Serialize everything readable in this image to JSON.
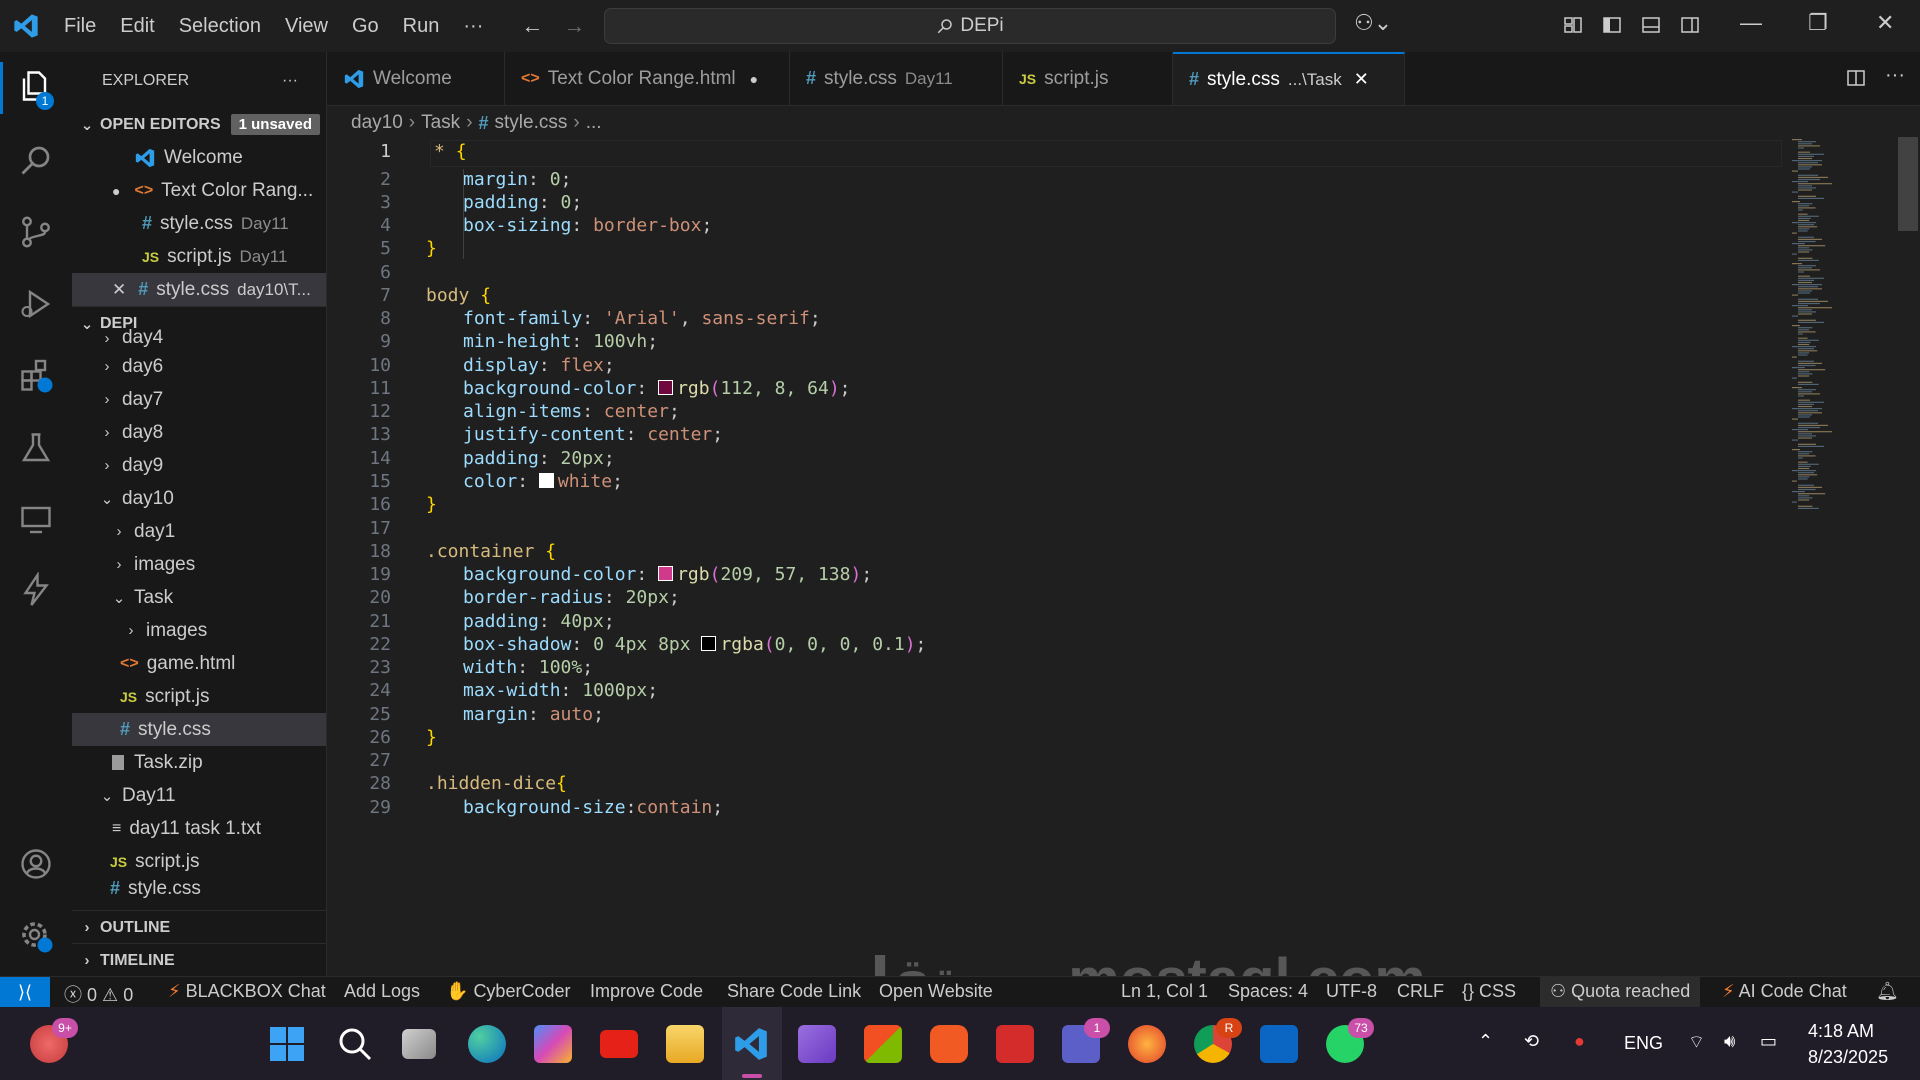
{
  "titlebar": {
    "menu": [
      "File",
      "Edit",
      "Selection",
      "View",
      "Go",
      "Run",
      "···"
    ],
    "search_text": "DEPi"
  },
  "sidebar": {
    "explorer_title": "EXPLORER",
    "explorer_more": "···",
    "open_editors_label": "OPEN EDITORS",
    "unsaved_badge": "1 unsaved",
    "open_editors": [
      {
        "name": "Welcome",
        "desc": ""
      },
      {
        "name": "Text Color Rang...",
        "desc": ""
      },
      {
        "name": "style.css",
        "desc": "Day11"
      },
      {
        "name": "script.js",
        "desc": "Day11"
      },
      {
        "name": "style.css",
        "desc": "day10\\T..."
      }
    ],
    "workspace_label": "DEPI",
    "tree": [
      "day4",
      "day6",
      "day7",
      "day8",
      "day9",
      "day10",
      "day1",
      "images",
      "Task",
      "images",
      "game.html",
      "script.js",
      "style.css",
      "Task.zip",
      "Day11",
      "day11 task 1.txt",
      "script.js",
      "style.css"
    ],
    "outline_label": "OUTLINE",
    "timeline_label": "TIMELINE"
  },
  "activity_badge": "1",
  "tabs": [
    {
      "name": "Welcome",
      "desc": ""
    },
    {
      "name": "Text Color Range.html",
      "desc": ""
    },
    {
      "name": "style.css",
      "desc": "Day11"
    },
    {
      "name": "script.js",
      "desc": ""
    },
    {
      "name": "style.css",
      "desc": "...\\Task"
    }
  ],
  "breadcrumb": [
    "day10",
    "Task",
    "style.css",
    "..."
  ],
  "code": {
    "line_numbers": [
      "1",
      "2",
      "3",
      "4",
      "5",
      "6",
      "7",
      "8",
      "9",
      "10",
      "11",
      "12",
      "13",
      "14",
      "15",
      "16",
      "17",
      "18",
      "19",
      "20",
      "21",
      "22",
      "23",
      "24",
      "25",
      "26",
      "27",
      "28",
      "29"
    ],
    "l1_sel": "*",
    "p_margin": "margin",
    "v_0a": "0",
    "p_padding": "padding",
    "v_0b": "0",
    "p_boxsizing": "box-sizing",
    "v_borderbox": "border-box",
    "s_body": "body",
    "p_fontfamily": "font-family",
    "v_arial": "'Arial'",
    "v_sansserif": "sans-serif",
    "p_minheight": "min-height",
    "v_100vh": "100vh",
    "p_display": "display",
    "v_flex": "flex",
    "p_bgcolor1": "background-color",
    "v_rgb1_fn": "rgb",
    "v_rgb1_args": "112, 8, 64",
    "p_alignitems": "align-items",
    "v_center1": "center",
    "p_justify": "justify-content",
    "v_center2": "center",
    "p_padding2": "padding",
    "v_20px": "20px",
    "p_color": "color",
    "v_white": "white",
    "s_container": ".container",
    "p_bgcolor2": "background-color",
    "v_rgb2_fn": "rgb",
    "v_rgb2_args": "209, 57, 138",
    "p_radius": "border-radius",
    "v_20px_b": "20px",
    "p_padding3": "padding",
    "v_40px": "40px",
    "p_shadow": "box-shadow",
    "v_shadow_nums": "0 4px 8px",
    "v_rgba_fn": "rgba",
    "v_rgba_args": "0, 0, 0, 0.1",
    "p_width": "width",
    "v_100p": "100%",
    "p_maxwidth": "max-width",
    "v_1000px": "1000px",
    "p_margin2": "margin",
    "v_auto": "auto",
    "s_hiddendice": ".hidden-dice",
    "p_bgsize": "background-size",
    "v_contain": "contain"
  },
  "swatch_colors": {
    "rgb1": "#700840",
    "white": "#ffffff",
    "rgb2": "#d1398a",
    "rgba": "#000000"
  },
  "statusbar": {
    "problems_errors": "0",
    "problems_warnings": "0",
    "items_left": [
      "BLACKBOX Chat",
      "Add Logs",
      "CyberCoder",
      "Improve Code",
      "Share Code Link",
      "Open Website"
    ],
    "position": "Ln 1, Col 1",
    "spaces": "Spaces: 4",
    "encoding": "UTF-8",
    "eol": "CRLF",
    "language": "CSS",
    "quota": "Quota reached",
    "ai_chat": "AI Code Chat"
  },
  "taskbar": {
    "badge_copilot": "9+",
    "badge_teams": "1",
    "badge_whatsapp": "73",
    "badge_chrome": "R",
    "lang": "ENG",
    "time": "4:18 AM",
    "date": "8/23/2025"
  },
  "watermark": "مستقل mostaql.com"
}
